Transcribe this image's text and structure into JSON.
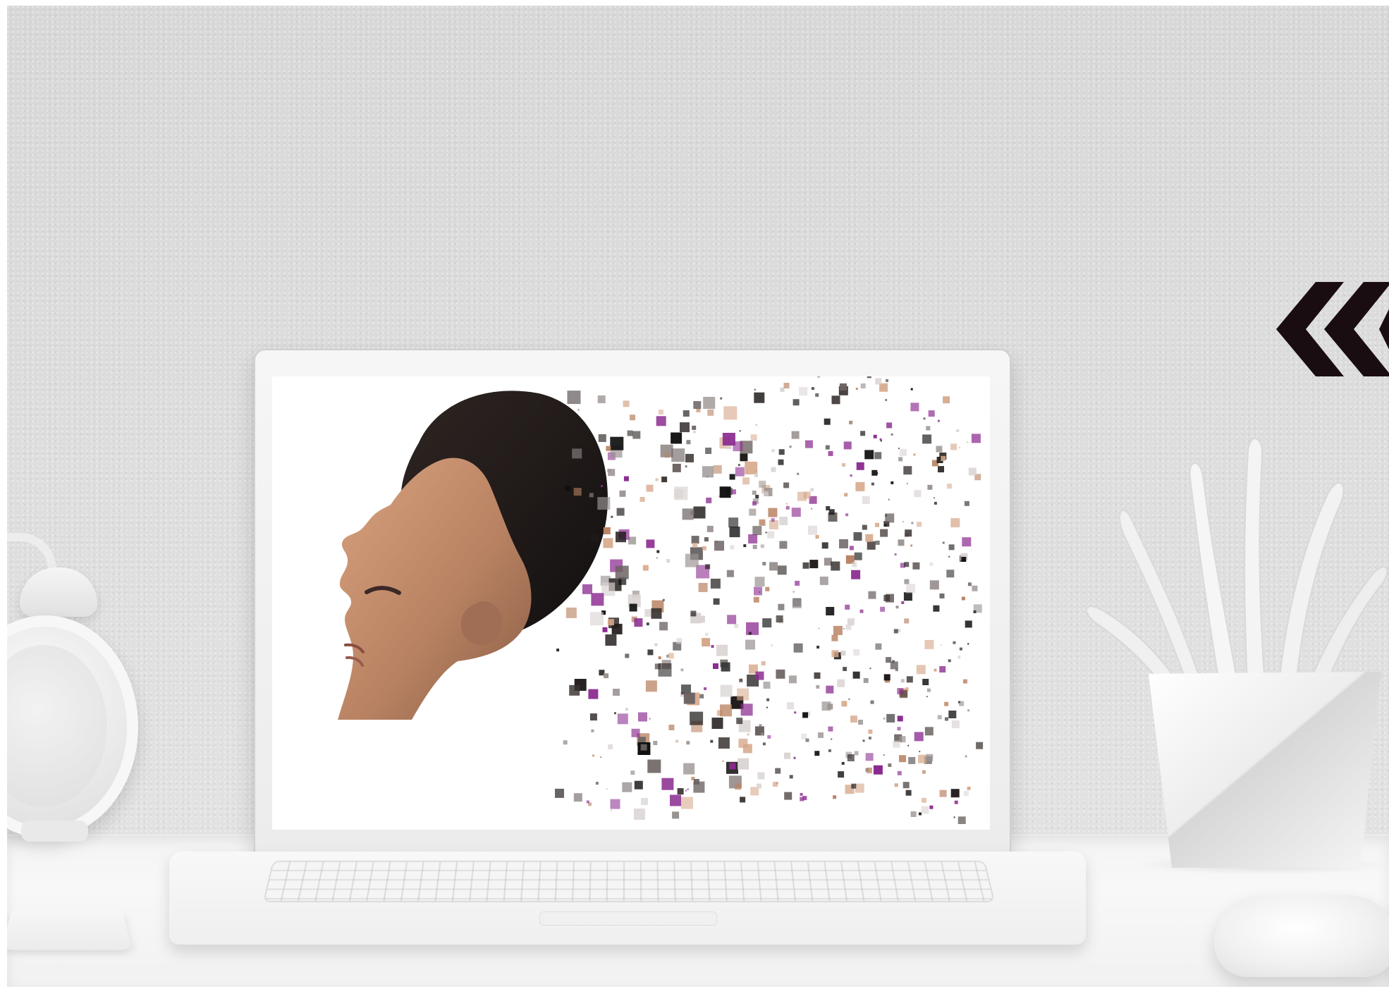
{
  "scene": {
    "subject": "laptop-on-desk",
    "screen_art": "pixel-dispersion-portrait"
  },
  "colors": {
    "background": "#ffffff",
    "wall": "#dcdcdc",
    "desk": "#f5f5f5",
    "laptop": "#ececec",
    "hair": "#1f1a19",
    "skin": "#b98363",
    "accent_purple": "#8a2a8f",
    "logo": "#1a0d12"
  },
  "icons": {
    "logo_mark": "chevron-left-icon",
    "clock": "alarm-clock-icon",
    "plant": "plant-icon",
    "mouse": "mouse-icon"
  }
}
